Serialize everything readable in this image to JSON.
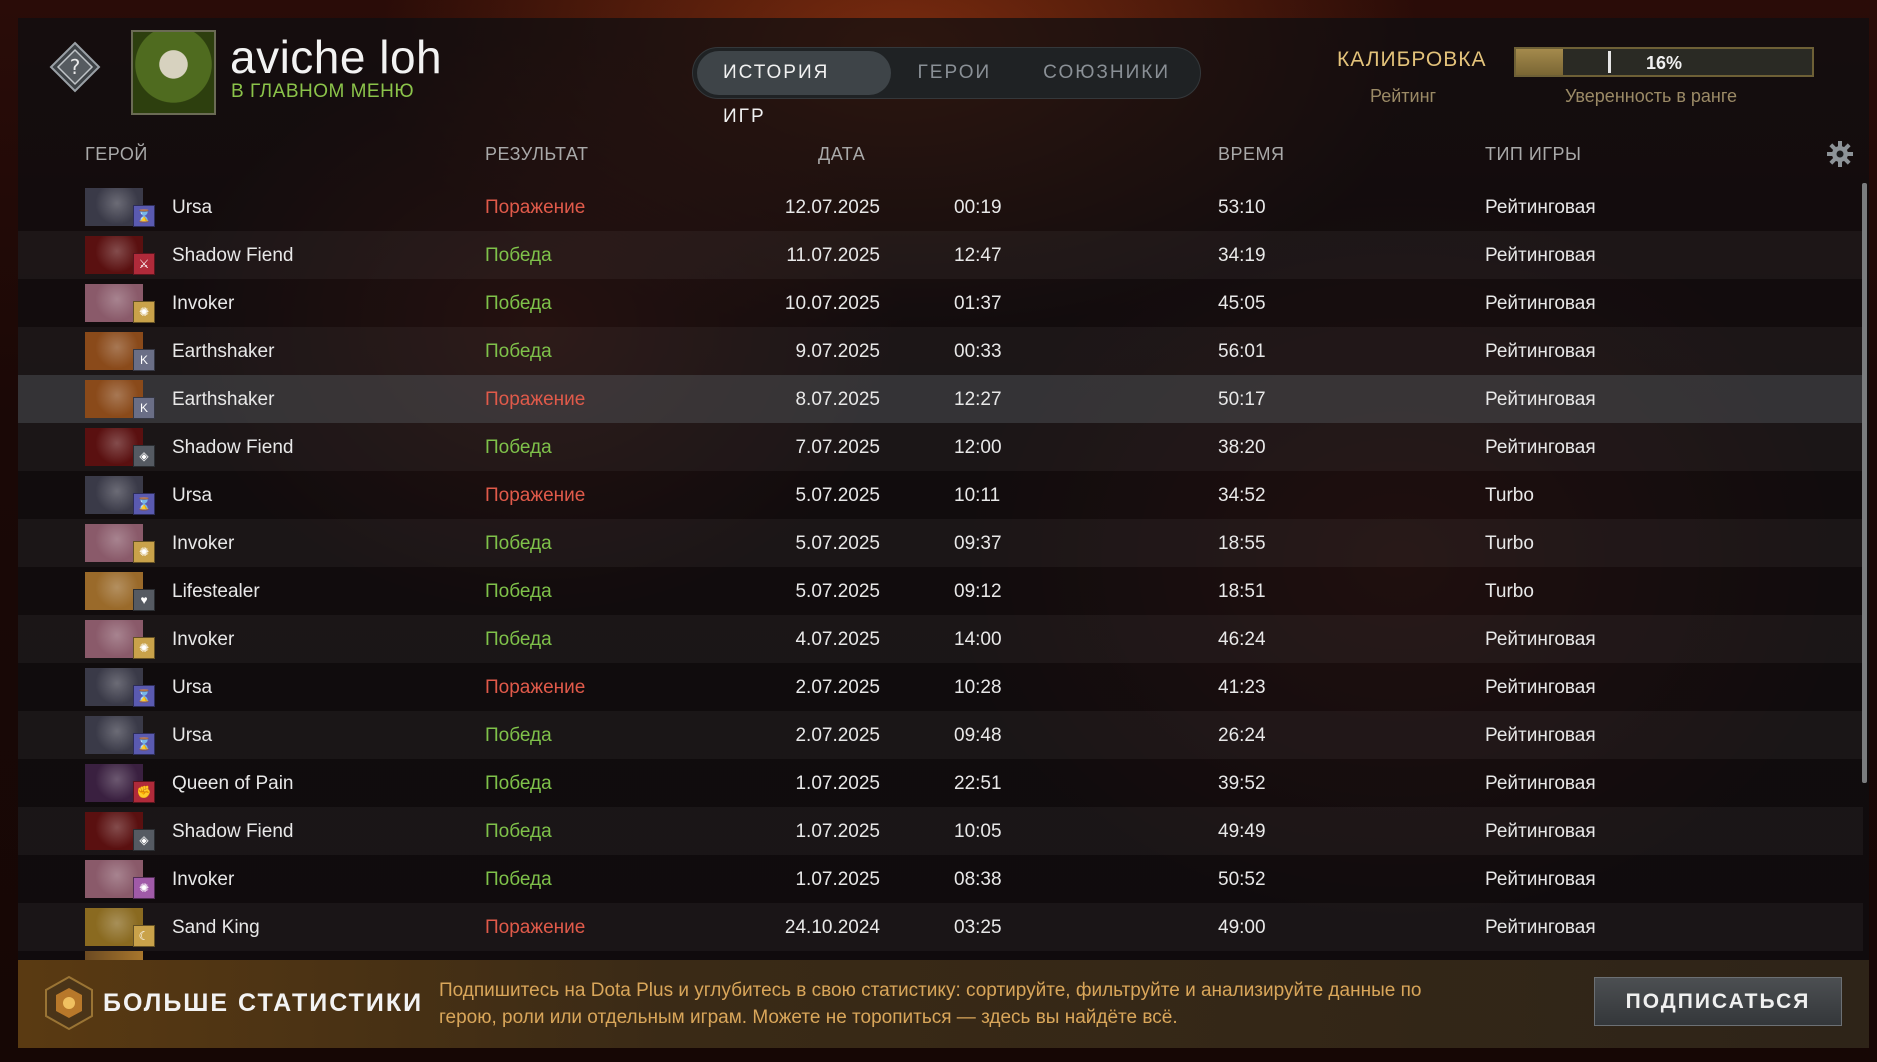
{
  "profile": {
    "name": "aviche loh",
    "status": "В ГЛАВНОМ МЕНЮ",
    "rank_icon": "unknown-rank-icon"
  },
  "tabs": [
    {
      "label": "ИСТОРИЯ ИГР",
      "active": true
    },
    {
      "label": "ГЕРОИ",
      "active": false
    },
    {
      "label": "СОЮЗНИКИ",
      "active": false
    }
  ],
  "calibration": {
    "label": "КАЛИБРОВКА",
    "rating_label": "Рейтинг",
    "confidence_value": "16%",
    "confidence_fraction": 0.16,
    "confidence_label": "Уверенность в ранге"
  },
  "table": {
    "headers": {
      "hero": "ГЕРОЙ",
      "result": "РЕЗУЛЬТАТ",
      "date": "ДАТА",
      "duration": "ВРЕМЯ",
      "type": "ТИП ИГРЫ"
    },
    "rows": [
      {
        "hero": "Ursa",
        "result": "Поражение",
        "outcome": "loss",
        "date": "12.07.2025",
        "time": "00:19",
        "duration": "53:10",
        "type": "Рейтинговая",
        "portrait": "#3a3a48",
        "badge": "#5a5ab0",
        "badge_icon": "⌛"
      },
      {
        "hero": "Shadow Fiend",
        "result": "Победа",
        "outcome": "win",
        "date": "11.07.2025",
        "time": "12:47",
        "duration": "34:19",
        "type": "Рейтинговая",
        "portrait": "#5a1010",
        "badge": "#b02a3a",
        "badge_icon": "⚔"
      },
      {
        "hero": "Invoker",
        "result": "Победа",
        "outcome": "win",
        "date": "10.07.2025",
        "time": "01:37",
        "duration": "45:05",
        "type": "Рейтинговая",
        "portrait": "#8a5a6a",
        "badge": "#c9a24a",
        "badge_icon": "✺"
      },
      {
        "hero": "Earthshaker",
        "result": "Победа",
        "outcome": "win",
        "date": "9.07.2025",
        "time": "00:33",
        "duration": "56:01",
        "type": "Рейтинговая",
        "portrait": "#8a4a1a",
        "badge": "#6a6e86",
        "badge_icon": "K"
      },
      {
        "hero": "Earthshaker",
        "result": "Поражение",
        "outcome": "loss",
        "date": "8.07.2025",
        "time": "12:27",
        "duration": "50:17",
        "type": "Рейтинговая",
        "portrait": "#8a4a1a",
        "badge": "#6a6e86",
        "badge_icon": "K",
        "selected": true
      },
      {
        "hero": "Shadow Fiend",
        "result": "Победа",
        "outcome": "win",
        "date": "7.07.2025",
        "time": "12:00",
        "duration": "38:20",
        "type": "Рейтинговая",
        "portrait": "#5a1010",
        "badge": "#555a62",
        "badge_icon": "◈"
      },
      {
        "hero": "Ursa",
        "result": "Поражение",
        "outcome": "loss",
        "date": "5.07.2025",
        "time": "10:11",
        "duration": "34:52",
        "type": "Turbo",
        "portrait": "#3a3a48",
        "badge": "#5a5ab0",
        "badge_icon": "⌛"
      },
      {
        "hero": "Invoker",
        "result": "Победа",
        "outcome": "win",
        "date": "5.07.2025",
        "time": "09:37",
        "duration": "18:55",
        "type": "Turbo",
        "portrait": "#8a5a6a",
        "badge": "#c9a24a",
        "badge_icon": "✺"
      },
      {
        "hero": "Lifestealer",
        "result": "Победа",
        "outcome": "win",
        "date": "5.07.2025",
        "time": "09:12",
        "duration": "18:51",
        "type": "Turbo",
        "portrait": "#9a6a2a",
        "badge": "#555a62",
        "badge_icon": "♥"
      },
      {
        "hero": "Invoker",
        "result": "Победа",
        "outcome": "win",
        "date": "4.07.2025",
        "time": "14:00",
        "duration": "46:24",
        "type": "Рейтинговая",
        "portrait": "#8a5a6a",
        "badge": "#c9a24a",
        "badge_icon": "✺"
      },
      {
        "hero": "Ursa",
        "result": "Поражение",
        "outcome": "loss",
        "date": "2.07.2025",
        "time": "10:28",
        "duration": "41:23",
        "type": "Рейтинговая",
        "portrait": "#3a3a48",
        "badge": "#5a5ab0",
        "badge_icon": "⌛"
      },
      {
        "hero": "Ursa",
        "result": "Победа",
        "outcome": "win",
        "date": "2.07.2025",
        "time": "09:48",
        "duration": "26:24",
        "type": "Рейтинговая",
        "portrait": "#3a3a48",
        "badge": "#5a5ab0",
        "badge_icon": "⌛"
      },
      {
        "hero": "Queen of Pain",
        "result": "Победа",
        "outcome": "win",
        "date": "1.07.2025",
        "time": "22:51",
        "duration": "39:52",
        "type": "Рейтинговая",
        "portrait": "#3a2040",
        "badge": "#b02a3a",
        "badge_icon": "✊"
      },
      {
        "hero": "Shadow Fiend",
        "result": "Победа",
        "outcome": "win",
        "date": "1.07.2025",
        "time": "10:05",
        "duration": "49:49",
        "type": "Рейтинговая",
        "portrait": "#5a1010",
        "badge": "#555a62",
        "badge_icon": "◈"
      },
      {
        "hero": "Invoker",
        "result": "Победа",
        "outcome": "win",
        "date": "1.07.2025",
        "time": "08:38",
        "duration": "50:52",
        "type": "Рейтинговая",
        "portrait": "#8a5a6a",
        "badge": "#a05aa8",
        "badge_icon": "✺"
      },
      {
        "hero": "Sand King",
        "result": "Поражение",
        "outcome": "loss",
        "date": "24.10.2024",
        "time": "03:25",
        "duration": "49:00",
        "type": "Рейтинговая",
        "portrait": "#8a6a20",
        "badge": "#c9a24a",
        "badge_icon": "☾"
      }
    ]
  },
  "promo": {
    "title": "БОЛЬШЕ СТАТИСТИКИ",
    "text": "Подпишитесь на Dota Plus и углубитесь в свою статистику: сортируйте, фильтруйте и анализируйте данные по герою, роли или отдельным играм. Можете не торопиться — здесь вы найдёте всё.",
    "button_label": "ПОДПИСАТЬСЯ"
  },
  "colors": {
    "win": "#7fc24a",
    "loss": "#e05a4a",
    "gold": "#e3c27a"
  }
}
